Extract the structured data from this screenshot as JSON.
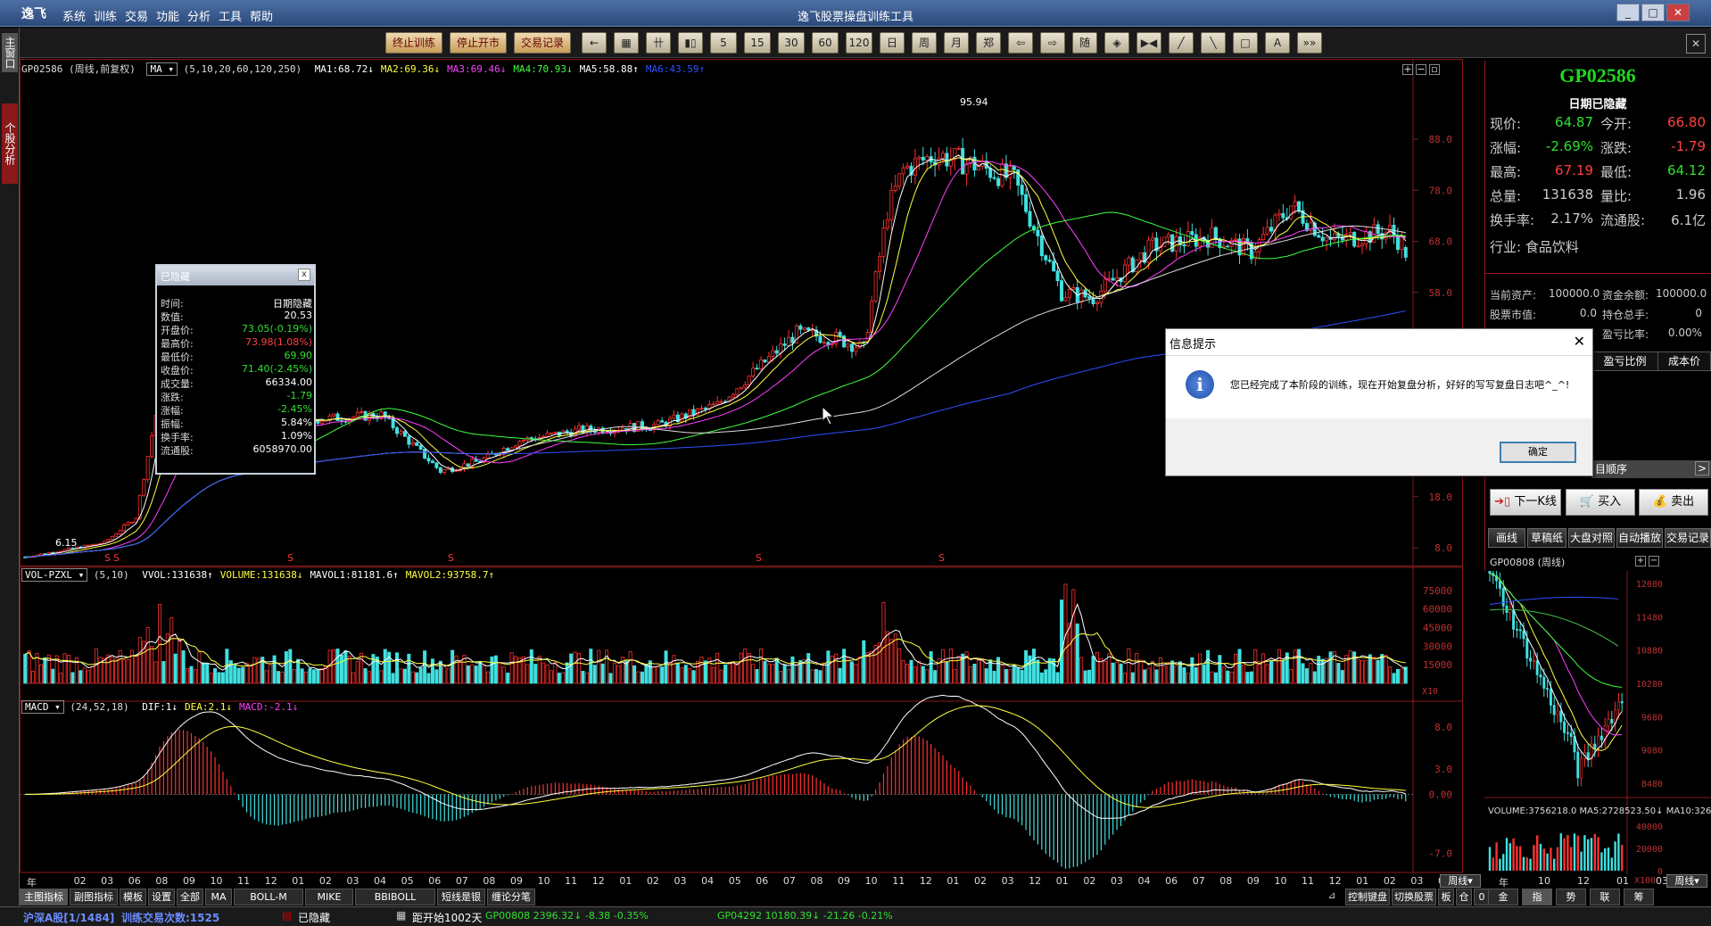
{
  "app": {
    "logo": "逸飞",
    "title": "逸飞股票操盘训练工具",
    "menu": [
      "系统",
      "训练",
      "交易",
      "功能",
      "分析",
      "工具",
      "帮助"
    ]
  },
  "toolbar": {
    "buttons": [
      "终止训练",
      "停止开市",
      "交易记录",
      "←",
      "▦",
      "卄",
      "▮▯",
      "5",
      "15",
      "30",
      "60",
      "120",
      "日",
      "周",
      "月",
      "郑",
      "⇦",
      "⇨",
      "随",
      "◈",
      "▶◀",
      "╱",
      "╲",
      "□",
      "A",
      "»»"
    ]
  },
  "leftstrip": {
    "tabs": [
      "主窗口",
      "个股分析"
    ]
  },
  "main_chart": {
    "info": "GP02586 (周线,前复权)",
    "ma_select": "MA",
    "params": "(5,10,20,60,120,250)",
    "ma": [
      {
        "label": "MA1:68.72↓",
        "color": "#ffffff"
      },
      {
        "label": "MA2:69.36↓",
        "color": "#ffff40"
      },
      {
        "label": "MA3:69.46↓",
        "color": "#ff40ff"
      },
      {
        "label": "MA4:70.93↓",
        "color": "#40ff40"
      },
      {
        "label": "MA5:58.88↑",
        "color": "#ffffff"
      },
      {
        "label": "MA6:43.59↑",
        "color": "#3050ff"
      }
    ],
    "high_label": "95.94",
    "low_label": "6.15",
    "y_ticks": [
      "88.0",
      "78.0",
      "68.0",
      "58.0",
      "48.0",
      "38.0",
      "28.0",
      "18.0",
      "8.0"
    ]
  },
  "volume_chart": {
    "select": "VOL-PZXL",
    "params": "(5,10)",
    "labels": [
      {
        "t": "VVOL:131638↑",
        "c": "#ffffff"
      },
      {
        "t": "VOLUME:131638↓",
        "c": "#ffff40"
      },
      {
        "t": "MAVOL1:81181.6↑",
        "c": "#ffffff"
      },
      {
        "t": "MAVOL2:93758.7↑",
        "c": "#ffff40"
      }
    ],
    "y_ticks": [
      "75000",
      "60000",
      "45000",
      "30000",
      "15000"
    ],
    "unit": "X10"
  },
  "macd_chart": {
    "select": "MACD",
    "params": "(24,52,18)",
    "labels": [
      {
        "t": "DIF:1↓",
        "c": "#ffffff"
      },
      {
        "t": "DEA:2.1↓",
        "c": "#ffff40"
      },
      {
        "t": "MACD:-2.1↓",
        "c": "#ff40ff"
      }
    ],
    "y_ticks": [
      "8.0",
      "3.0",
      "0.00",
      "-7.0"
    ]
  },
  "x_axis": [
    "年",
    "02",
    "03",
    "06",
    "08",
    "09",
    "10",
    "11",
    "12",
    "01",
    "02",
    "03",
    "04",
    "05",
    "06",
    "07",
    "08",
    "09",
    "10",
    "11",
    "12",
    "01",
    "02",
    "03",
    "04",
    "05",
    "06",
    "07",
    "08",
    "09",
    "10",
    "11",
    "12",
    "01",
    "02",
    "03",
    "12",
    "01",
    "02",
    "03",
    "04",
    "06",
    "07",
    "08",
    "09",
    "10",
    "11",
    "12",
    "01",
    "02",
    "03",
    "04"
  ],
  "period_select": "周线",
  "tooltip": {
    "title": "已隐藏",
    "rows": [
      {
        "k": "时间:",
        "v": "日期隐藏",
        "c": "#ffffff"
      },
      {
        "k": "数值:",
        "v": "20.53",
        "c": "#ffffff"
      },
      {
        "k": "开盘价:",
        "v": "73.05(-0.19%)",
        "c": "#30e030"
      },
      {
        "k": "最高价:",
        "v": "73.98(1.08%)",
        "c": "#ff4040"
      },
      {
        "k": "最低价:",
        "v": "69.90",
        "c": "#30e030"
      },
      {
        "k": "收盘价:",
        "v": "71.40(-2.45%)",
        "c": "#30e030"
      },
      {
        "k": "成交量:",
        "v": "66334.00",
        "c": "#ffffff"
      },
      {
        "k": "涨跌:",
        "v": "-1.79",
        "c": "#30e030"
      },
      {
        "k": "涨幅:",
        "v": "-2.45%",
        "c": "#30e030"
      },
      {
        "k": "振幅:",
        "v": "5.84%",
        "c": "#ffffff"
      },
      {
        "k": "换手率:",
        "v": "1.09%",
        "c": "#ffffff"
      },
      {
        "k": "流通股:",
        "v": "6058970.00",
        "c": "#ffffff"
      }
    ]
  },
  "dialog": {
    "title": "信息提示",
    "message": "您已经完成了本阶段的训练，现在开始复盘分析，好好的写写复盘日志吧^_^!",
    "ok": "确定"
  },
  "right": {
    "code": "GP02586",
    "date_hidden": "日期已隐藏",
    "quote": [
      {
        "k1": "现价:",
        "v1": "64.87",
        "c1": "#30e030",
        "k2": "今开:",
        "v2": "66.80",
        "c2": "#ff4040"
      },
      {
        "k1": "涨幅:",
        "v1": "-2.69%",
        "c1": "#30e030",
        "k2": "涨跌:",
        "v2": "-1.79",
        "c2": "#ff4040"
      },
      {
        "k1": "最高:",
        "v1": "67.19",
        "c1": "#ff4040",
        "k2": "最低:",
        "v2": "64.12",
        "c2": "#30e030"
      },
      {
        "k1": "总量:",
        "v1": "131638",
        "c1": "#cccccc",
        "k2": "量比:",
        "v2": "1.96",
        "c2": "#cccccc"
      },
      {
        "k1": "换手率:",
        "v1": "2.17%",
        "c1": "#cccccc",
        "k2": "流通股:",
        "v2": "6.1亿",
        "c2": "#cccccc"
      }
    ],
    "industry": "行业: 食品饮料",
    "account": [
      {
        "k1": "当前资产:",
        "v1": "100000.0",
        "k2": "资金余额:",
        "v2": "100000.0"
      },
      {
        "k1": "股票市值:",
        "v1": "0.0",
        "k2": "持仓总手:",
        "v2": "0"
      },
      {
        "k1": "",
        "v1": "",
        "k2": "盈亏比率:",
        "v2": "0.00%"
      }
    ],
    "holding_headers": [
      "盈亏比例",
      "成本价"
    ],
    "order_tab": "目顺序",
    "actions": [
      "下一K线",
      "买入",
      "卖出"
    ],
    "tools": [
      "画线",
      "草稿纸",
      "大盘对照",
      "自动播放",
      "交易记录"
    ],
    "mini": {
      "title": "GP00808 (周线)",
      "y_ticks": [
        "12080",
        "11480",
        "10880",
        "10280",
        "9680",
        "9080",
        "8480"
      ],
      "vol_label": "VOLUME:3756218.0 MA5:2728523.50↓ MA10:3264",
      "vol_ticks": [
        "40000",
        "20000",
        "0"
      ],
      "x": [
        "年",
        "10",
        "12",
        "01",
        "03",
        "04"
      ],
      "period": "周线",
      "unit": "X100"
    }
  },
  "bottom_tabs": [
    "主图指标",
    "副图指标",
    "模板",
    "设置",
    "全部",
    "MA",
    "BOLL-M",
    "MIKE",
    "BBIBOLL",
    "短线是银",
    "缠论分笔"
  ],
  "bottom_right": [
    "控制键盘",
    "切换股票",
    "板",
    "仓",
    "0"
  ],
  "right_tabs": [
    "金",
    "指",
    "势",
    "联",
    "筹"
  ],
  "status": {
    "market": "沪深A股[1/1484]",
    "trades": "训练交易次数:1525",
    "hidden": "已隐藏",
    "days": "距开始1002天",
    "idx1": "GP00808 2396.32↓ -8.38 -0.35%",
    "idx2": "GP04292 10180.39↓ -21.26 -0.21%"
  }
}
